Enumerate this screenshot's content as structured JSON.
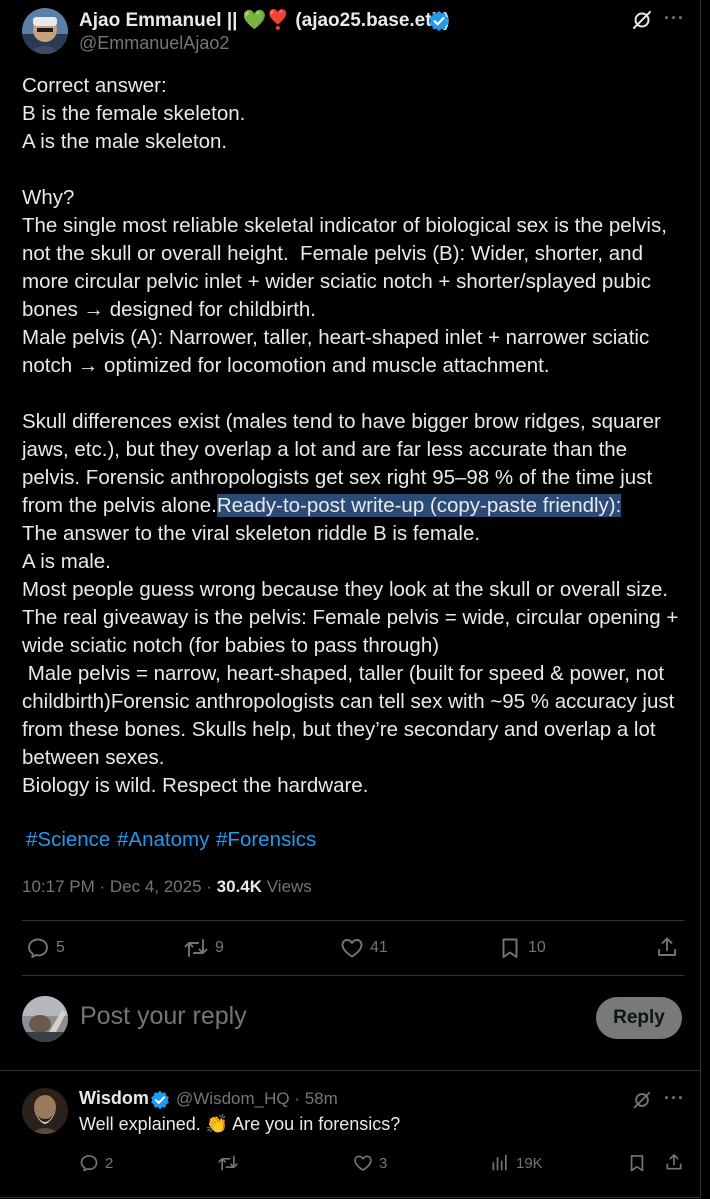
{
  "post": {
    "author_name": "Ajao Emmanuel || 💚❣️ (ajao25.base.eth)",
    "author_handle": "@EmmanuelAjao2",
    "paragraphs": [
      "Correct answer:\nB is the female skeleton.\nA is the male skeleton.",
      "",
      "Why?\nThe single most reliable skeletal indicator of biological sex is the pelvis, not the skull or overall height.  Female pelvis (B): Wider, shorter, and more circular pelvic inlet + wider sciatic notch + shorter/splayed pubic bones → designed for childbirth.\nMale pelvis (A): Narrower, taller, heart-shaped inlet + narrower sciatic notch → optimized for locomotion and muscle attachment.",
      "",
      "Skull differences exist (males tend to have bigger brow ridges, squarer jaws, etc.), but they overlap a lot and are far less accurate than the pelvis. Forensic anthropologists get sex right 95–98 % of the time just from the pelvis alone."
    ],
    "highlighted_text": "Ready-to-post write-up (copy-paste friendly):",
    "after_highlight": "\nThe answer to the viral skeleton riddle B is female.\nA is male.\nMost people guess wrong because they look at the skull or overall size.\nThe real giveaway is the pelvis: Female pelvis = wide, circular opening + wide sciatic notch (for babies to pass through)\n Male pelvis = narrow, heart-shaped, taller (built for speed & power, not childbirth)Forensic anthropologists can tell sex with ~95 % accuracy just from these bones. Skulls help, but they’re secondary and overlap a lot between sexes.\nBiology is wild. Respect the hardware.",
    "hashtags": "#Science #Anatomy #Forensics",
    "time": "10:17 PM · Dec 4, 2025 · ",
    "views_count": "30.4K",
    "views_label": " Views",
    "stats": {
      "replies": "5",
      "reposts": "9",
      "likes": "41",
      "bookmarks": "10"
    }
  },
  "composer": {
    "placeholder": "Post your reply",
    "reply_button": "Reply"
  },
  "reply": {
    "author_name": "Wisdom",
    "author_handle": "@Wisdom_HQ · 58m",
    "text": "Well explained. 👏 Are you in forensics?",
    "stats": {
      "replies": "2",
      "reposts": "",
      "likes": "3",
      "views": "19K"
    }
  },
  "icons": [
    "grok-icon",
    "more-icon",
    "verified-badge-icon",
    "reply-icon",
    "repost-icon",
    "like-icon",
    "bookmark-icon",
    "share-icon",
    "views-icon"
  ],
  "colors": {
    "accent": "#1d9bf0",
    "muted": "#71767b",
    "text": "#e7e9ea",
    "highlight": "#2b4a75",
    "reply_button": "#787a7a"
  }
}
